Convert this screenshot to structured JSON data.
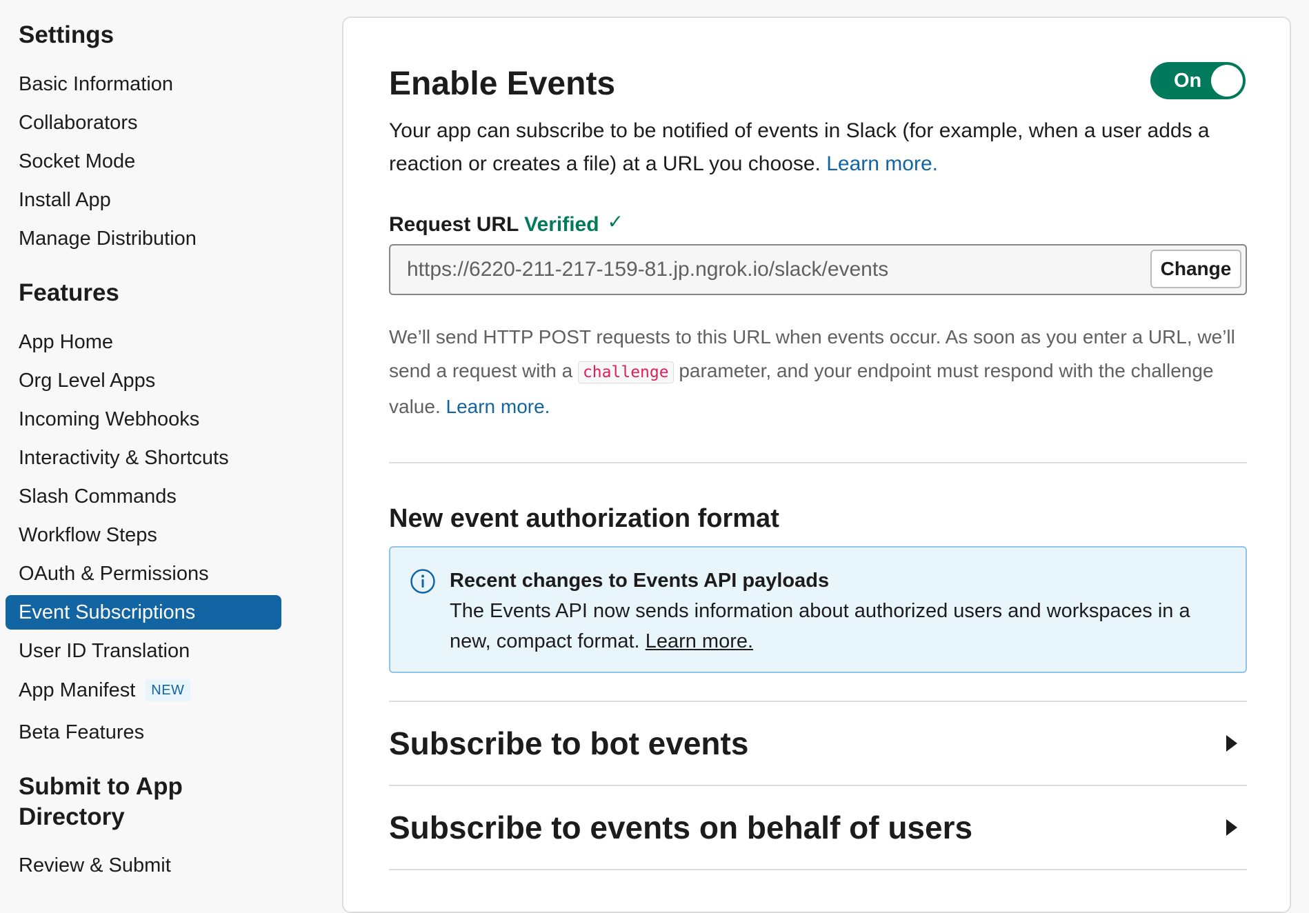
{
  "sidebar": {
    "settings_heading": "Settings",
    "settings_items": [
      {
        "label": "Basic Information"
      },
      {
        "label": "Collaborators"
      },
      {
        "label": "Socket Mode"
      },
      {
        "label": "Install App"
      },
      {
        "label": "Manage Distribution"
      }
    ],
    "features_heading": "Features",
    "features_items": [
      {
        "label": "App Home"
      },
      {
        "label": "Org Level Apps"
      },
      {
        "label": "Incoming Webhooks"
      },
      {
        "label": "Interactivity & Shortcuts"
      },
      {
        "label": "Slash Commands"
      },
      {
        "label": "Workflow Steps"
      },
      {
        "label": "OAuth & Permissions"
      },
      {
        "label": "Event Subscriptions",
        "active": true
      },
      {
        "label": "User ID Translation"
      },
      {
        "label": "App Manifest",
        "badge": "NEW"
      },
      {
        "label": "Beta Features"
      }
    ],
    "submit_heading_line1": "Submit to App",
    "submit_heading_line2": "Directory",
    "submit_items": [
      {
        "label": "Review & Submit"
      }
    ]
  },
  "main": {
    "title": "Enable Events",
    "toggle": {
      "label": "On",
      "state": "on"
    },
    "description": "Your app can subscribe to be notified of events in Slack (for example, when a user adds a reaction or creates a file) at a URL you choose.",
    "description_link": "Learn more.",
    "request_url_label": "Request URL",
    "verified_label": "Verified",
    "check_glyph": "✓",
    "request_url_value": "https://6220-211-217-159-81.jp.ngrok.io/slack/events",
    "change_button": "Change",
    "help_part1": "We’ll send HTTP POST requests to this URL when events occur. As soon as you enter a URL, we’ll send a request with a",
    "help_code": "challenge",
    "help_part2": "parameter, and your endpoint must respond with the challenge value.",
    "help_link": "Learn more.",
    "auth_format_title": "New event authorization format",
    "info_box": {
      "title": "Recent changes to Events API payloads",
      "body": "The Events API now sends information about authorized users and workspaces in a new, compact format.",
      "link": "Learn more."
    },
    "sections": [
      {
        "title": "Subscribe to bot events"
      },
      {
        "title": "Subscribe to events on behalf of users"
      }
    ]
  },
  "colors": {
    "accent_blue": "#1264a3",
    "toggle_green": "#007a5a",
    "code_red": "#e01e5a",
    "info_bg": "#e8f5fa"
  },
  "icons": [
    "info-icon",
    "check-icon",
    "caret-right-icon"
  ]
}
